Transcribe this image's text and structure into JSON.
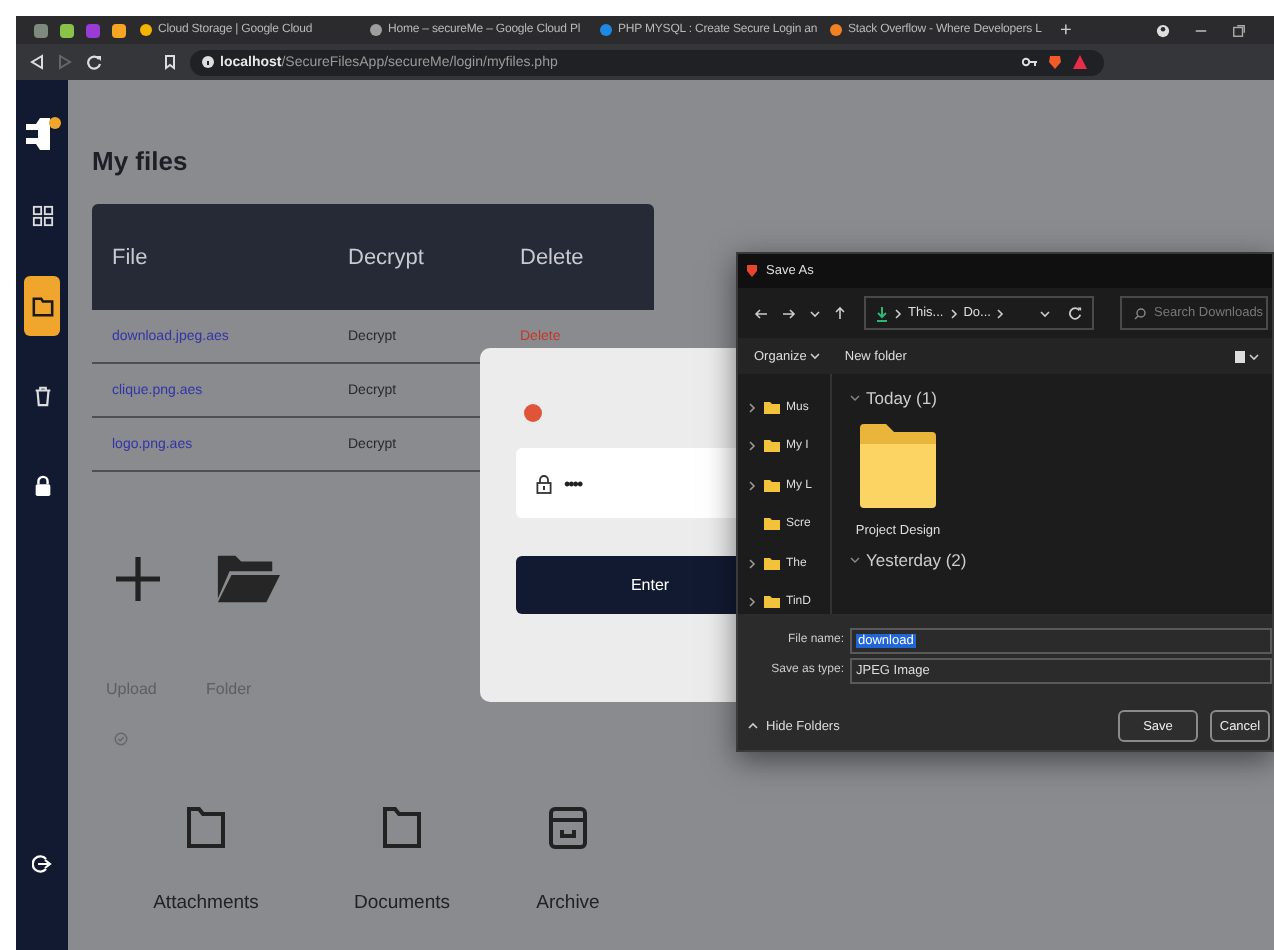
{
  "browser": {
    "pinned_tabs": [
      {
        "color": "#7d8a7d"
      },
      {
        "color": "#8bc34a"
      },
      {
        "color": "#9b3bd6"
      },
      {
        "color": "#f5a623"
      }
    ],
    "tabs": [
      {
        "title": "Cloud Storage | Google Cloud",
        "color": "#f4b400"
      },
      {
        "title": "Home – secureMe – Google Cloud Pl",
        "color": "#9e9e9e"
      },
      {
        "title": "PHP MYSQL : Create Secure Login an",
        "color": "#1e88e5"
      },
      {
        "title": "Stack Overflow - Where Developers L",
        "color": "#f48024"
      }
    ],
    "new_tab": "+",
    "forward_disabled": true,
    "url": {
      "host": "localhost",
      "path": "/SecureFilesApp/secureMe/login/myfiles.php"
    }
  },
  "sidebar": {
    "items": [
      {
        "kind": "dashboard",
        "selected": false
      },
      {
        "kind": "files",
        "selected": true
      },
      {
        "kind": "trash",
        "selected": false
      },
      {
        "kind": "lock",
        "selected": false
      }
    ]
  },
  "page_title": "My files",
  "table": {
    "columns": [
      "File",
      "Decrypt",
      "Delete"
    ],
    "rows": [
      {
        "file": "download.jpeg.aes",
        "decrypt": "Decrypt",
        "delete": "Delete"
      },
      {
        "file": "clique.png.aes",
        "decrypt": "Decrypt"
      },
      {
        "file": "logo.png.aes",
        "decrypt": "Decrypt"
      }
    ]
  },
  "actions": [
    {
      "kind": "upload",
      "label": "Upload"
    },
    {
      "kind": "folder",
      "label": "Folder"
    }
  ],
  "categories": [
    {
      "kind": "folder",
      "label": "Attachments"
    },
    {
      "kind": "folder",
      "label": "Documents"
    },
    {
      "kind": "archive",
      "label": "Archive"
    }
  ],
  "password_modal": {
    "value": "••••",
    "button": "Enter"
  },
  "save_dialog": {
    "title": "Save As",
    "breadcrumb": [
      "This...",
      "Do..."
    ],
    "search_placeholder": "Search Downloads",
    "organize": "Organize",
    "new_folder": "New folder",
    "nav_items": [
      {
        "label": "Mus",
        "expandable": true
      },
      {
        "label": "My I",
        "expandable": true
      },
      {
        "label": "My L",
        "expandable": true
      },
      {
        "label": "Scre",
        "expandable": false
      },
      {
        "label": "The",
        "expandable": true
      },
      {
        "label": "TinD",
        "expandable": true
      }
    ],
    "groups": [
      {
        "label": "Today (1)",
        "items": [
          "Project Design"
        ]
      },
      {
        "label": "Yesterday (2)"
      }
    ],
    "file_name": {
      "label": "File name:",
      "value": "download",
      "value_selected": true
    },
    "save_type": {
      "label": "Save as type:",
      "value": "JPEG Image"
    },
    "hide_folders": "Hide Folders",
    "buttons": [
      "Save",
      "Cancel"
    ]
  }
}
